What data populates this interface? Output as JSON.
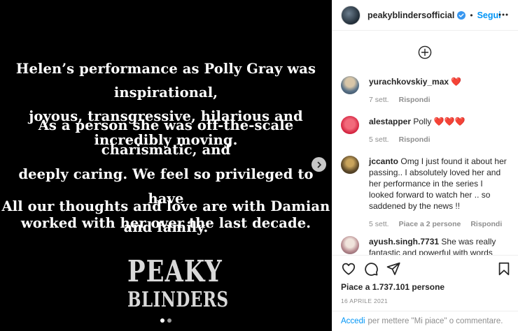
{
  "post_image": {
    "quote_lines_1": [
      "Helen’s performance as Polly Gray was inspirational,",
      "joyous, transgressive, hilarious and incredibly moving."
    ],
    "quote_lines_2": [
      "As a person she was off-the-scale charismatic, and",
      "deeply caring. We feel so privileged to have",
      "worked with her over the last decade."
    ],
    "quote_lines_3": [
      "All our thoughts and love are with Damian and family."
    ],
    "logo_line_1": "PEAKY",
    "logo_line_2": "BLINDERS",
    "carousel": {
      "total": 2,
      "current": 1
    },
    "next_icon": "chevron-right-icon"
  },
  "header": {
    "username": "peakyblindersofficial",
    "separator": "•",
    "follow_label": "Segui",
    "verified_icon": "verified-badge-icon",
    "more_icon": "more-horizontal-icon"
  },
  "comments": {
    "load_more_icon": "plus-circle-icon",
    "items": [
      {
        "user": "yurachkovskiy_max",
        "text": "❤️",
        "time": "7 sett.",
        "likes": "",
        "reply": "Rispondi"
      },
      {
        "user": "alestapper",
        "text": "Polly ❤️❤️❤️",
        "time": "5 sett.",
        "likes": "",
        "reply": "Rispondi"
      },
      {
        "user": "jccanto",
        "text": "Omg I just found it about her passing.. I absolutely loved her and her performance in the series I looked forward to watch her .. so saddened by the news !!",
        "time": "5 sett.",
        "likes": "Piace a 2 persone",
        "reply": "Rispondi"
      },
      {
        "user": "ayush.singh.7731",
        "text": "She was really fantastic and powerful with words",
        "time": "",
        "likes": "",
        "reply": ""
      }
    ]
  },
  "actions": {
    "like_icon": "heart-icon",
    "comment_icon": "comment-icon",
    "share_icon": "send-icon",
    "save_icon": "bookmark-icon"
  },
  "likes_text": "Piace a 1.737.101 persone",
  "date_text": "16 APRILE 2021",
  "footer": {
    "login_label": "Accedi",
    "rest_text": "per mettere \"Mi piace\" o commentare."
  },
  "colors": {
    "accent": "#0095f6",
    "heart": "#ed4956",
    "muted": "#8e8e8e",
    "text": "#262626"
  }
}
